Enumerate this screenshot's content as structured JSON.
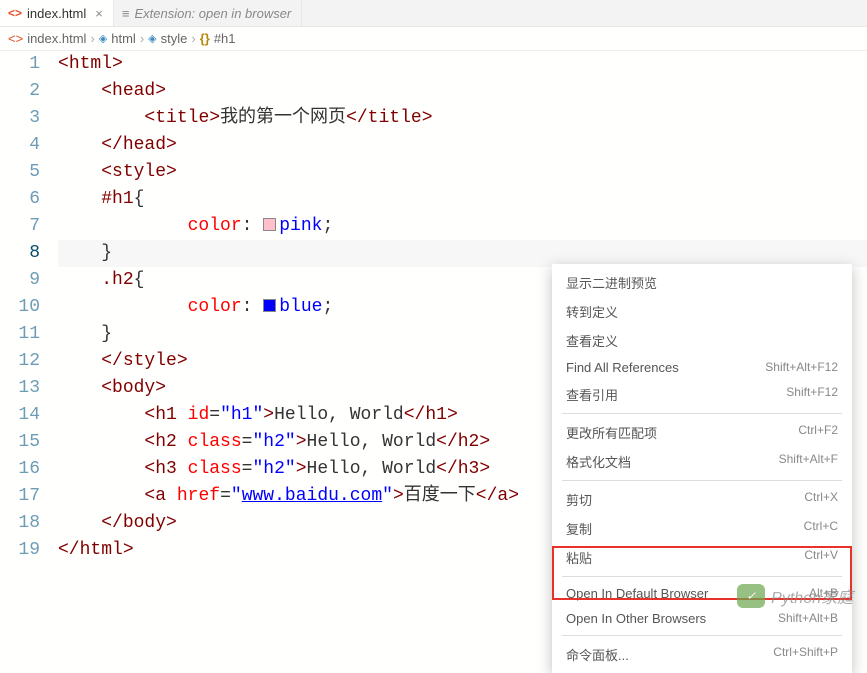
{
  "tabs": [
    {
      "label": "index.html",
      "active": true,
      "icon": "html"
    },
    {
      "label": "Extension: open in browser",
      "active": false,
      "icon": "gear"
    }
  ],
  "breadcrumbs": [
    {
      "icon": "html",
      "label": "index.html"
    },
    {
      "icon": "cube",
      "label": "html"
    },
    {
      "icon": "cube",
      "label": "style"
    },
    {
      "icon": "brace",
      "label": "#h1"
    }
  ],
  "code_lines": [
    {
      "n": 1,
      "indent": 0,
      "kind": "tag-open",
      "tag": "html"
    },
    {
      "n": 2,
      "indent": 1,
      "kind": "tag-open",
      "tag": "head"
    },
    {
      "n": 3,
      "indent": 2,
      "kind": "tag-full",
      "tag": "title",
      "text": "我的第一个网页"
    },
    {
      "n": 4,
      "indent": 1,
      "kind": "tag-close",
      "tag": "head"
    },
    {
      "n": 5,
      "indent": 1,
      "kind": "tag-open",
      "tag": "style"
    },
    {
      "n": 6,
      "indent": 1,
      "kind": "css-sel",
      "sel": "#h1",
      "brace": "{"
    },
    {
      "n": 7,
      "indent": 2,
      "kind": "css-decl",
      "prop": "color",
      "swatch": "pink",
      "val": "pink"
    },
    {
      "n": 8,
      "indent": 1,
      "kind": "css-brace",
      "brace": "}",
      "hl": true
    },
    {
      "n": 9,
      "indent": 1,
      "kind": "css-sel",
      "sel": ".h2",
      "brace": "{"
    },
    {
      "n": 10,
      "indent": 2,
      "kind": "css-decl",
      "prop": "color",
      "swatch": "blue",
      "val": "blue"
    },
    {
      "n": 11,
      "indent": 1,
      "kind": "css-brace",
      "brace": "}"
    },
    {
      "n": 12,
      "indent": 1,
      "kind": "tag-close",
      "tag": "style"
    },
    {
      "n": 13,
      "indent": 1,
      "kind": "tag-open",
      "tag": "body"
    },
    {
      "n": 14,
      "indent": 2,
      "kind": "tag-attr",
      "tag": "h1",
      "attr": "id",
      "aval": "h1",
      "text": "Hello, World"
    },
    {
      "n": 15,
      "indent": 2,
      "kind": "tag-attr",
      "tag": "h2",
      "attr": "class",
      "aval": "h2",
      "text": "Hello, World"
    },
    {
      "n": 16,
      "indent": 2,
      "kind": "tag-attr",
      "tag": "h3",
      "attr": "class",
      "aval": "h2",
      "text": "Hello, World"
    },
    {
      "n": 17,
      "indent": 2,
      "kind": "tag-link",
      "tag": "a",
      "attr": "href",
      "aval": "www.baidu.com",
      "text": "百度一下"
    },
    {
      "n": 18,
      "indent": 1,
      "kind": "tag-close",
      "tag": "body"
    },
    {
      "n": 19,
      "indent": 0,
      "kind": "tag-close",
      "tag": "html"
    }
  ],
  "context_menu": {
    "groups": [
      [
        {
          "label": "显示二进制预览",
          "shortcut": ""
        },
        {
          "label": "转到定义",
          "shortcut": ""
        },
        {
          "label": "查看定义",
          "shortcut": ""
        },
        {
          "label": "Find All References",
          "shortcut": "Shift+Alt+F12"
        },
        {
          "label": "查看引用",
          "shortcut": "Shift+F12"
        }
      ],
      [
        {
          "label": "更改所有匹配项",
          "shortcut": "Ctrl+F2"
        },
        {
          "label": "格式化文档",
          "shortcut": "Shift+Alt+F"
        }
      ],
      [
        {
          "label": "剪切",
          "shortcut": "Ctrl+X"
        },
        {
          "label": "复制",
          "shortcut": "Ctrl+C"
        },
        {
          "label": "粘贴",
          "shortcut": "Ctrl+V"
        }
      ],
      [
        {
          "label": "Open In Default Browser",
          "shortcut": "Alt+B"
        },
        {
          "label": "Open In Other Browsers",
          "shortcut": "Shift+Alt+B"
        }
      ],
      [
        {
          "label": "命令面板...",
          "shortcut": "Ctrl+Shift+P"
        }
      ]
    ]
  },
  "watermark": "Python家庭"
}
